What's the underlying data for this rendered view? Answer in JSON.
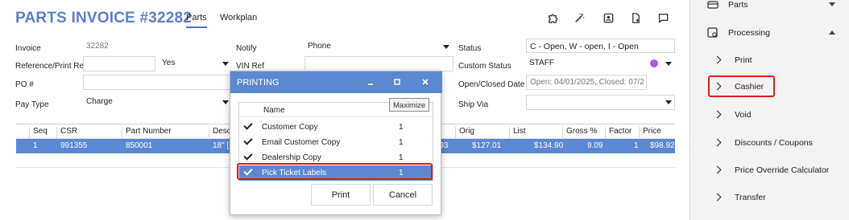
{
  "header": {
    "title": "PARTS INVOICE #32282",
    "tabs": [
      {
        "label": "Parts",
        "active": true
      },
      {
        "label": "Workplan",
        "active": false
      }
    ],
    "icons": [
      "puzzle-icon",
      "magic-wand-icon",
      "id-card-icon",
      "add-document-icon",
      "comment-icon"
    ]
  },
  "form": {
    "invoice_label": "Invoice",
    "invoice_value": "32282",
    "ref_label": "Reference/Print Ref",
    "ref_value": "",
    "ref_select": "Yes",
    "po_label": "PO #",
    "po_value": "",
    "paytype_label": "Pay Type",
    "paytype_value": "Charge",
    "notify_label": "Notify",
    "notify_value": "Phone",
    "vinref_label": "VIN Ref",
    "status_label": "Status",
    "status_value": "C - Open, W - open, I - Open",
    "custom_status_label": "Custom Status",
    "custom_status_value": "STAFF",
    "open_closed_label": "Open/Closed Date",
    "open_closed_value": "Open: 04/01/2025, Closed: 07/2",
    "shipvia_label": "Ship Via",
    "shipvia_value": ""
  },
  "grid": {
    "columns": [
      "Seq",
      "CSR",
      "Part Number",
      "Desc",
      "Orig",
      "List",
      "Gross %",
      "Factor",
      "Price"
    ],
    "rows": [
      {
        "seq": "1",
        "csr": "991355",
        "part": "850001",
        "desc": "18\" [",
        "prev": "0.93",
        "orig": "$127.01",
        "list": "$134.90",
        "gross": "9.09",
        "factor": "1",
        "price": "$98.92"
      }
    ]
  },
  "right_panel": {
    "sections": [
      {
        "label": "Parts",
        "icon": "printer-icon",
        "expanded": false
      },
      {
        "label": "Processing",
        "icon": "processing-icon",
        "expanded": true
      }
    ],
    "items": [
      "Print",
      "Cashier",
      "Void",
      "Discounts / Coupons",
      "Price Override Calculator",
      "Transfer"
    ]
  },
  "dialog": {
    "title": "PRINTING",
    "columns": [
      "Name",
      ""
    ],
    "rows": [
      {
        "name": "Customer Copy",
        "qty": "1",
        "checked": true,
        "selected": false
      },
      {
        "name": "Email Customer Copy",
        "qty": "1",
        "checked": true,
        "selected": false
      },
      {
        "name": "Dealership Copy",
        "qty": "1",
        "checked": true,
        "selected": false
      },
      {
        "name": "Pick Ticket Labels",
        "qty": "1",
        "checked": true,
        "selected": true
      }
    ],
    "print_label": "Print",
    "cancel_label": "Cancel",
    "tooltip": "Maximize"
  },
  "colors": {
    "accent": "#5b88d1",
    "title": "#5b7fc7",
    "highlight": "#e11b1b",
    "status_dot": "#a45fe0"
  }
}
